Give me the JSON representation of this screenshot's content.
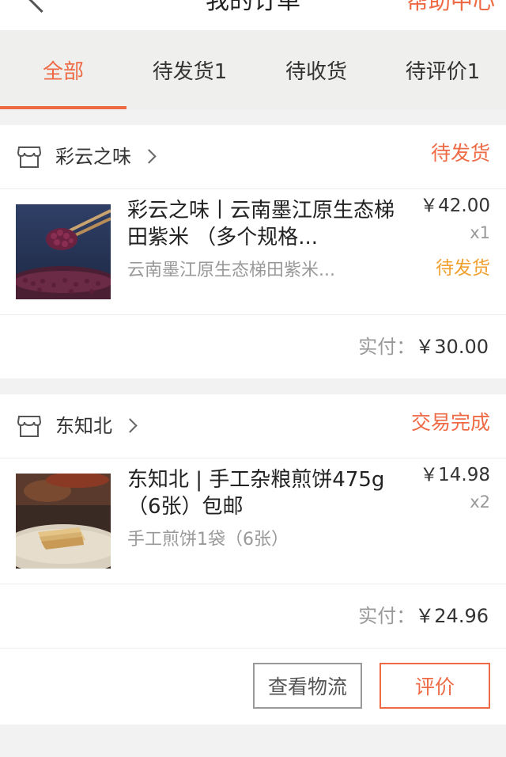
{
  "nav": {
    "title": "我的订单",
    "right_link": "帮助中心"
  },
  "tabs": [
    {
      "label": "全部",
      "active": true
    },
    {
      "label": "待发货1",
      "active": false
    },
    {
      "label": "待收货",
      "active": false
    },
    {
      "label": "待评价1",
      "active": false
    }
  ],
  "orders": [
    {
      "store": "彩云之味",
      "status": "待发货",
      "item": {
        "title": "彩云之味丨云南墨江原生态梯田紫米 （多个规格...",
        "spec": "云南墨江原生态梯田紫米...",
        "price": "￥42.00",
        "qty": "x1",
        "item_status": "待发货",
        "image": "purple-rice-photo"
      },
      "total_label": "实付：",
      "total_amount": "￥30.00"
    },
    {
      "store": "东知北",
      "status": "交易完成",
      "item": {
        "title": "东知北 | 手工杂粮煎饼475g （6张）包邮",
        "spec": "手工煎饼1袋（6张）",
        "price": "￥14.98",
        "qty": "x2",
        "image": "pancake-photo"
      },
      "total_label": "实付：",
      "total_amount": "￥24.96",
      "actions": {
        "logistics": "查看物流",
        "review": "评价"
      }
    }
  ],
  "colors": {
    "accent": "#ee6a45",
    "pending": "#f0a030",
    "tab_bg": "#efefed",
    "page_bg": "#f2f2f2"
  }
}
